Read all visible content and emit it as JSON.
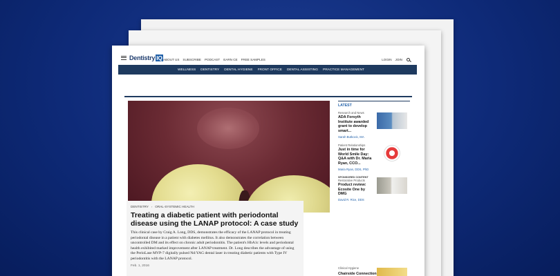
{
  "site": {
    "logo_main": "Dentistry",
    "logo_accent": "IQ",
    "top_nav": [
      "ABOUT US",
      "SUBSCRIBE",
      "PODCAST",
      "EARN CE",
      "FREE SAMPLES"
    ],
    "login": "LOGIN",
    "join": "JOIN",
    "main_nav": [
      "WELLNESS",
      "DENTISTRY",
      "DENTAL HYGIENE",
      "FRONT OFFICE",
      "DENTAL ASSISTING",
      "PRACTICE MANAGEMENT"
    ]
  },
  "article": {
    "breadcrumb": [
      "DENTISTRY",
      "ORAL-SYSTEMIC HEALTH"
    ],
    "breadcrumb_sep": "›",
    "title": "Treating a diabetic patient with periodontal disease using the LANAP protocol: A case study",
    "excerpt": "This clinical case by Craig A. Long, DDS, demonstrates the efficacy of the LANAP protocol in treating periodontal disease in a patient with diabetes mellitus. It also demonstrates the correlation between uncontrolled DM and its effect on chronic adult periodontitis. The patient's HbA1c levels and periodontal health exhibited marked improvement after LANAP treatment. Dr. Long describes the advantage of using the PerioLase MVP-7 digitally pulsed Nd:YAG dental laser in treating diabetic patients with Type IV periodontitis with the LANAP protocol.",
    "date": "Feb. 1, 2016"
  },
  "sidebar": {
    "heading": "LATEST",
    "items": [
      {
        "category": "Research and News",
        "headline": "ADA Forsyth Institute awarded grant to develop smart...",
        "author": "Sarah Butkovic, MA",
        "sponsored": ""
      },
      {
        "category": "Patient Relationships",
        "headline": "Just in time for World Smile Day: Q&A with Dr. Maria Ryan, CCO...",
        "author": "Maria Ryan, DDS, PhD",
        "sponsored": ""
      },
      {
        "category": "Restorative Products",
        "headline": "Product review: Ecosite One by DMG",
        "author": "David R. Rice, DDS",
        "sponsored": "SPONSORED CONTENT"
      }
    ],
    "bottom_category": "Clinical Hygiene",
    "bottom_headline": "Chairside Connection"
  },
  "icons": {
    "menu": "hamburger-icon",
    "search": "search-icon"
  },
  "colors": {
    "navbar": "#1e3a5f",
    "accent": "#1f5fa8",
    "background": "#0e2a78"
  }
}
